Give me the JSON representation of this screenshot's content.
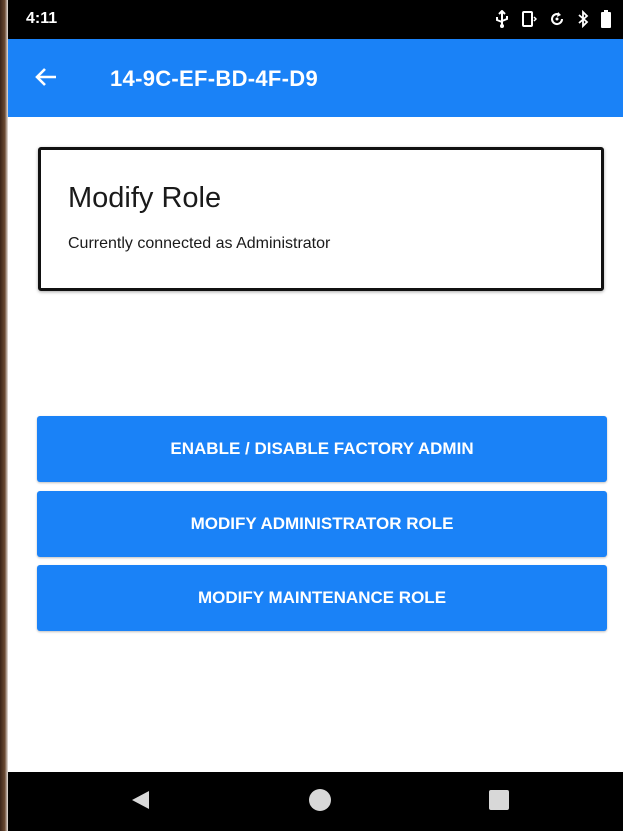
{
  "status_bar": {
    "time": "4:11",
    "icons": [
      "usb-icon",
      "cast-icon",
      "sync-icon",
      "bluetooth-icon",
      "battery-icon"
    ]
  },
  "app_bar": {
    "title": "14-9C-EF-BD-4F-D9",
    "back_icon": "arrow-back-icon"
  },
  "card": {
    "title": "Modify Role",
    "subtitle": "Currently connected as Administrator"
  },
  "actions": [
    {
      "label": "ENABLE / DISABLE FACTORY ADMIN"
    },
    {
      "label": "MODIFY ADMINISTRATOR ROLE"
    },
    {
      "label": "MODIFY MAINTENANCE ROLE"
    }
  ],
  "nav_bar": {
    "icons": [
      "nav-back-icon",
      "nav-home-icon",
      "nav-recents-icon"
    ]
  },
  "colors": {
    "primary": "#1a82f7",
    "status_bar": "#000000",
    "nav_bar": "#000000",
    "card_border": "#111111"
  }
}
